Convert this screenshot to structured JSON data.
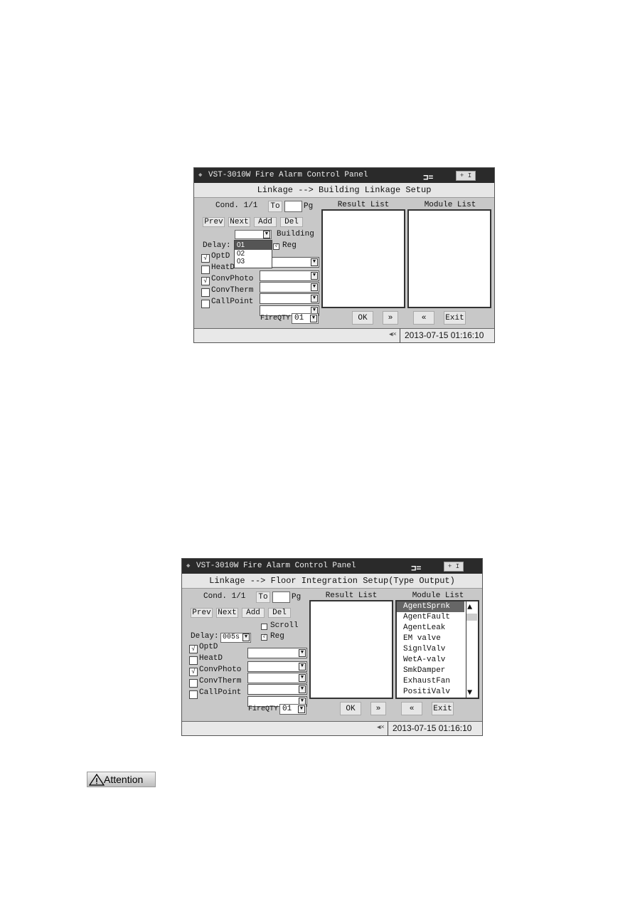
{
  "panel1": {
    "app_title": "VST-3010W Fire Alarm Control Panel",
    "battery": "+ I",
    "subtitle": "Linkage --> Building Linkage Setup",
    "cond": "Cond. 1/1",
    "to_label": "To",
    "pg_label": "Pg",
    "page_input": "",
    "buttons": {
      "prev": "Prev",
      "next": "Next",
      "add": "Add",
      "del": "Del",
      "ok": "OK",
      "forward": "»",
      "back": "«",
      "exit": "Exit"
    },
    "building_label": "Building",
    "building_value": "",
    "building_options": [
      "01",
      "02",
      "03"
    ],
    "building_selected": "01",
    "delay_label": "Delay:",
    "reg_label": "Reg",
    "reg_checked": true,
    "detectors": [
      {
        "label": "OptD",
        "checked": true
      },
      {
        "label": "HeatD",
        "checked": false
      },
      {
        "label": "ConvPhoto",
        "checked": true
      },
      {
        "label": "ConvTherm",
        "checked": false
      },
      {
        "label": "CallPoint",
        "checked": false
      }
    ],
    "fireqty_label": "FireQTY",
    "fireqty_value": "01",
    "result_list_title": "Result List",
    "module_list_title": "Module List",
    "module_list": [],
    "datetime": "2013-07-15  01:16:10"
  },
  "panel2": {
    "app_title": "VST-3010W Fire Alarm Control Panel",
    "battery": "+ I",
    "subtitle": "Linkage --> Floor Integration Setup(Type Output)",
    "cond": "Cond. 1/1",
    "to_label": "To",
    "pg_label": "Pg",
    "page_input": "",
    "buttons": {
      "prev": "Prev",
      "next": "Next",
      "add": "Add",
      "del": "Del",
      "ok": "OK",
      "forward": "»",
      "back": "«",
      "exit": "Exit"
    },
    "scroll_label": "Scroll",
    "scroll_checked": false,
    "delay_label": "Delay:",
    "delay_value": "005s",
    "reg_label": "Reg",
    "reg_checked": true,
    "detectors": [
      {
        "label": "OptD",
        "checked": true
      },
      {
        "label": "HeatD",
        "checked": false
      },
      {
        "label": "ConvPhoto",
        "checked": true
      },
      {
        "label": "ConvTherm",
        "checked": false
      },
      {
        "label": "CallPoint",
        "checked": false
      }
    ],
    "fireqty_label": "FireQTY",
    "fireqty_value": "01",
    "result_list_title": "Result List",
    "module_list_title": "Module List",
    "module_list": [
      "AgentSprnk",
      "AgentFault",
      "AgentLeak",
      "EM valve",
      "SignlValv",
      "WetA-valv",
      "SmkDamper",
      "ExhaustFan",
      "PositiValv"
    ],
    "module_selected": "AgentSprnk",
    "datetime": "2013-07-15  01:16:10"
  },
  "attention": {
    "label": "Attention",
    "icon": "warning-triangle-icon"
  }
}
